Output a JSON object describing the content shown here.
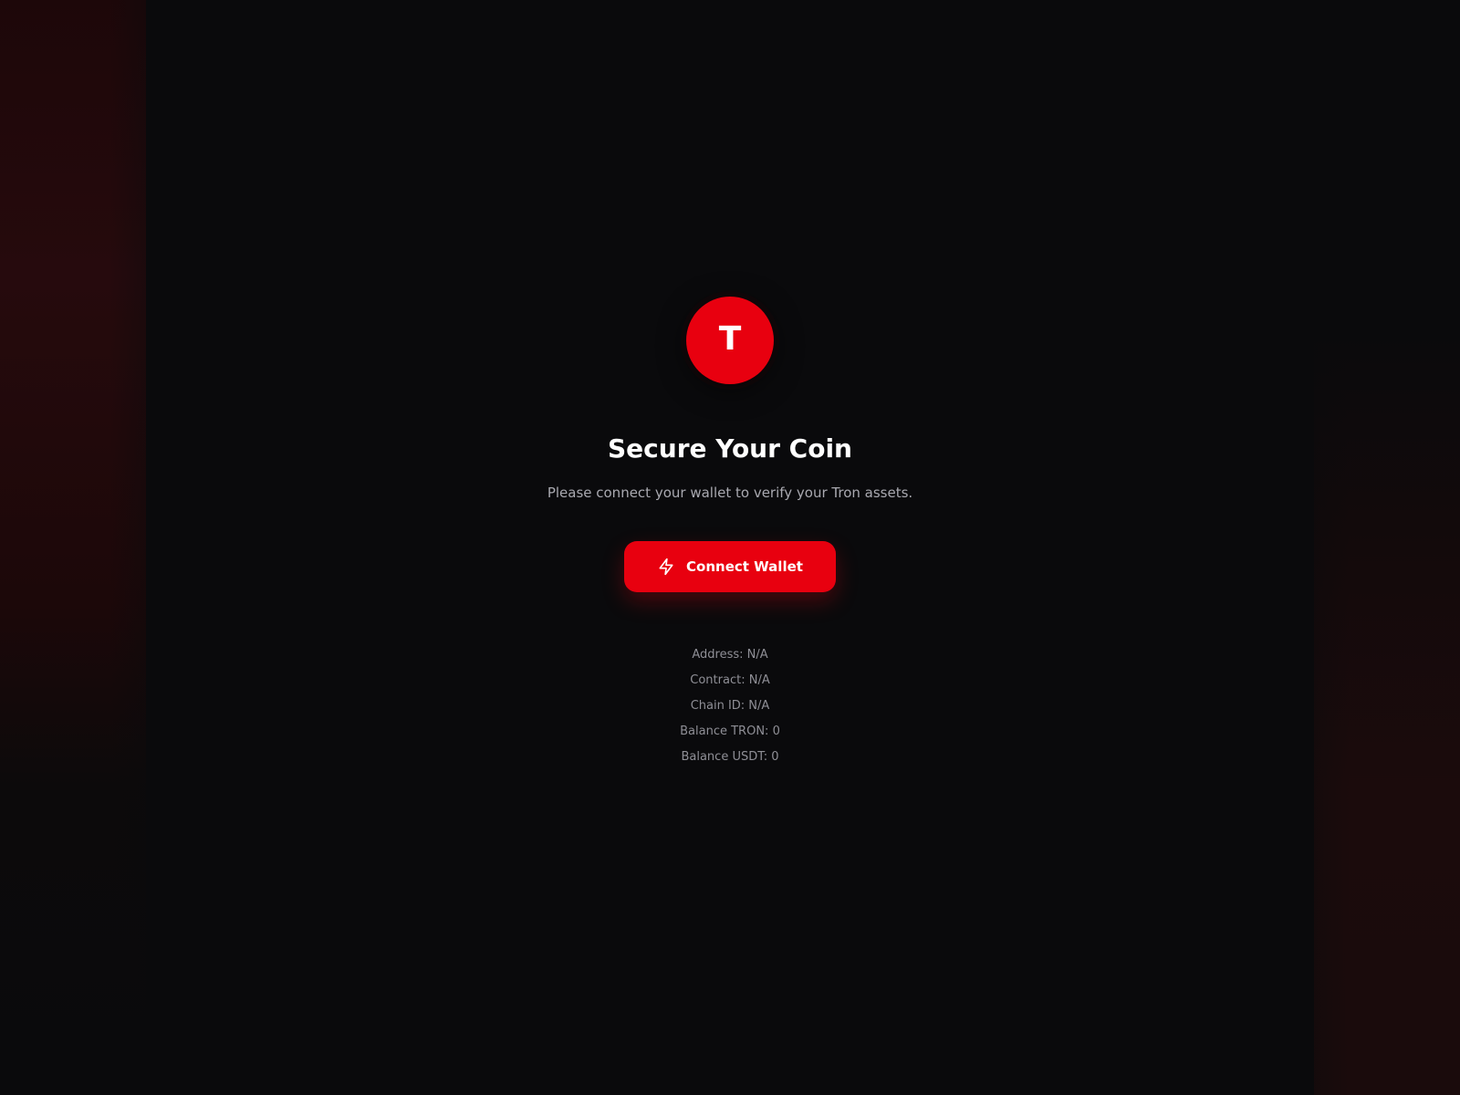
{
  "logo": {
    "letter": "T"
  },
  "heading": {
    "title": "Secure Your Coin",
    "subtitle": "Please connect your wallet to verify your Tron assets."
  },
  "connect_button": {
    "label": "Connect Wallet",
    "icon": "bolt-icon"
  },
  "wallet_info": {
    "address": "Address: N/A",
    "contract": "Contract: N/A",
    "chain_id": "Chain ID: N/A",
    "balance_tron": "Balance TRON: 0",
    "balance_usdt": "Balance USDT: 0"
  },
  "colors": {
    "background": "#0a0a0c",
    "accent": "#e8000f",
    "text_primary": "#ffffff",
    "text_secondary": "#a9a9b0",
    "text_muted": "#8f8f96"
  }
}
